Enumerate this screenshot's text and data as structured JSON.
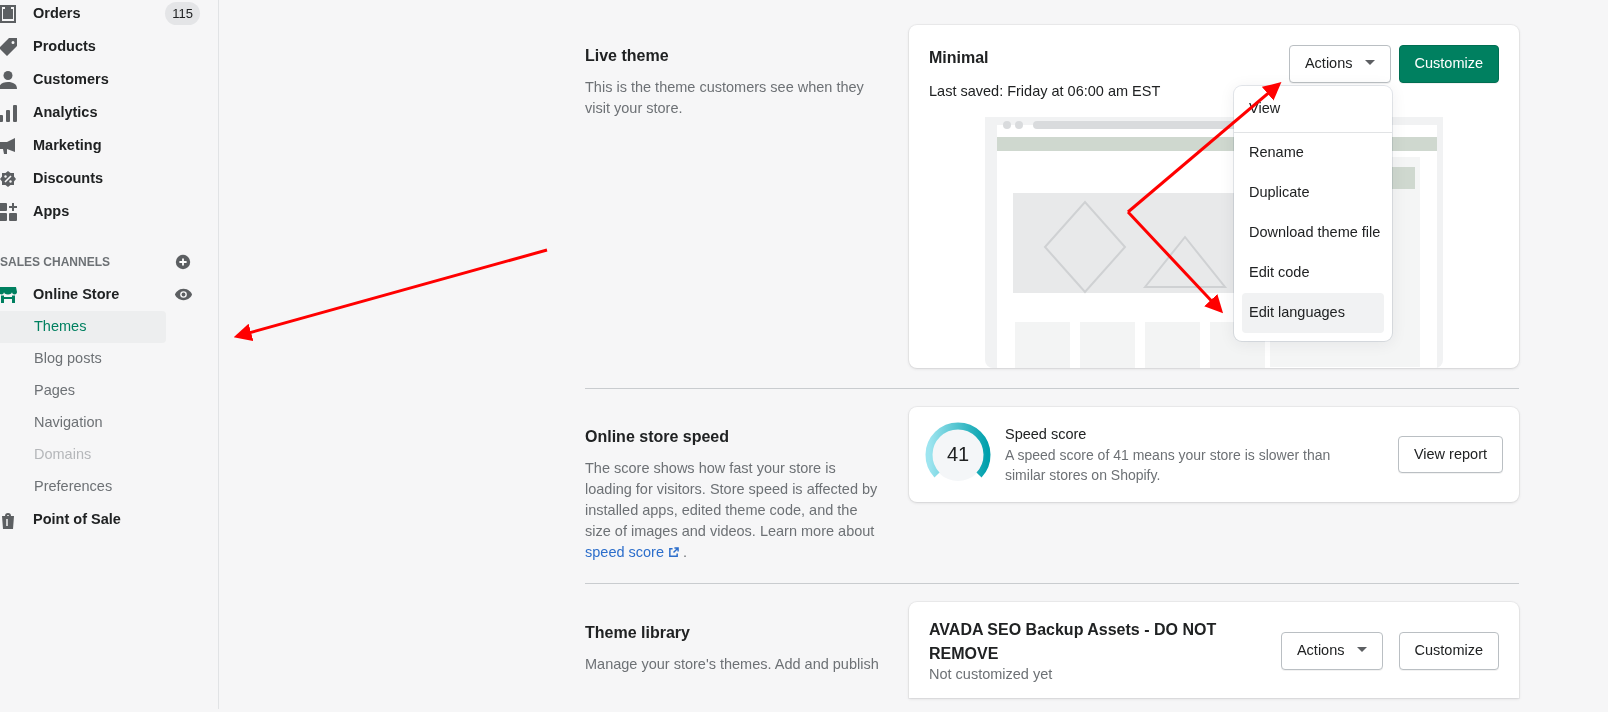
{
  "sidebar": {
    "items": [
      {
        "label": "Orders",
        "badge": "115"
      },
      {
        "label": "Products"
      },
      {
        "label": "Customers"
      },
      {
        "label": "Analytics"
      },
      {
        "label": "Marketing"
      },
      {
        "label": "Discounts"
      },
      {
        "label": "Apps"
      }
    ],
    "channels_heading": "SALES CHANNELS",
    "channels": [
      {
        "label": "Online Store",
        "expanded": true,
        "children": [
          {
            "label": "Themes",
            "selected": true,
            "disabled": false
          },
          {
            "label": "Blog posts",
            "selected": false,
            "disabled": false
          },
          {
            "label": "Pages",
            "selected": false,
            "disabled": false
          },
          {
            "label": "Navigation",
            "selected": false,
            "disabled": false
          },
          {
            "label": "Domains",
            "selected": false,
            "disabled": true
          },
          {
            "label": "Preferences",
            "selected": false,
            "disabled": false
          }
        ]
      },
      {
        "label": "Point of Sale",
        "expanded": false
      }
    ]
  },
  "sections": [
    {
      "kind": "live",
      "title": "Live theme",
      "description": "This is the theme customers see when they visit your store.",
      "card": {
        "name": "Minimal",
        "saved": "Last saved: Friday at 06:00 am EST",
        "actions": "Actions",
        "customize": "Customize",
        "menu": [
          {
            "label": "View",
            "highlighted": false
          },
          {
            "label": "Rename",
            "highlighted": false
          },
          {
            "label": "Duplicate",
            "highlighted": false
          },
          {
            "label": "Download theme file",
            "highlighted": false
          },
          {
            "label": "Edit code",
            "highlighted": false
          },
          {
            "label": "Edit languages",
            "highlighted": true
          }
        ]
      }
    },
    {
      "kind": "speed",
      "title": "Online store speed",
      "description": "The score shows how fast your store is loading for visitors. Store speed is affected by installed apps, edited theme code, and the size of images and videos. Learn more about",
      "link": "speed score",
      "after_link": ".",
      "card": {
        "score": "41",
        "heading": "Speed score",
        "text": "A speed score of 41 means your store is slower than similar stores on Shopify.",
        "button": "View report"
      }
    },
    {
      "kind": "library",
      "title": "Theme library",
      "description": "Manage your store's themes. Add and publish",
      "card": {
        "name": "AVADA SEO Backup Assets - DO NOT REMOVE",
        "status": "Not customized yet",
        "actions": "Actions",
        "customize": "Customize"
      }
    }
  ]
}
